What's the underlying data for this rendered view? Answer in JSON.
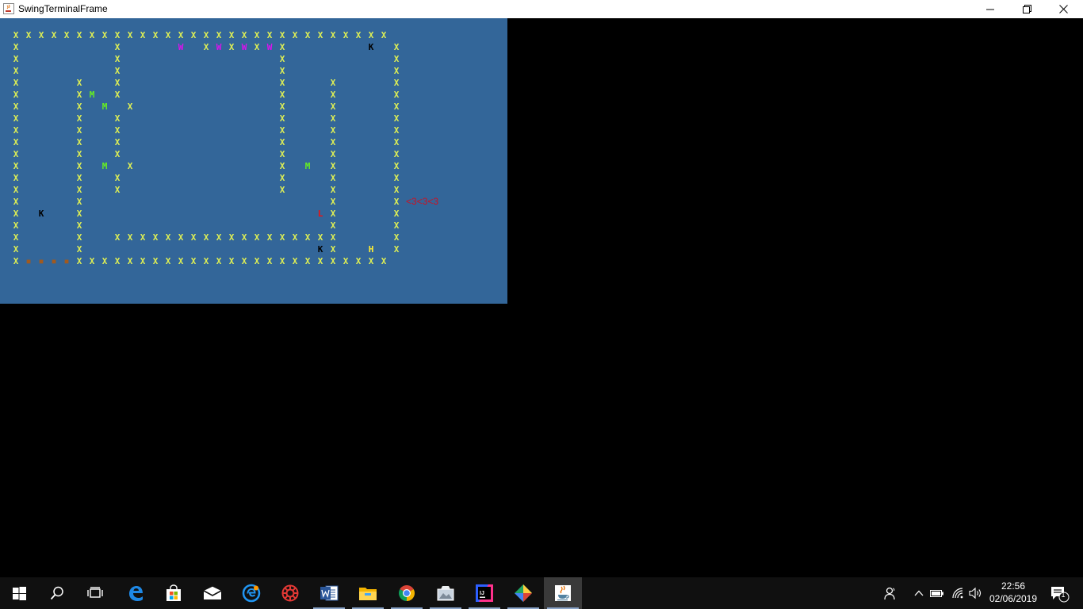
{
  "window": {
    "title": "SwingTerminalFrame"
  },
  "terminal": {
    "background": "#336699",
    "hearts": "<3<3<3",
    "grid_columns": 30,
    "grid_rows": 20,
    "rows": [
      "XXXXXXXXXXXXXXXXXXXXXXXXXXXXXX",
      "X       X    W XWXWXWX      K X",
      "X       X            X        X",
      "X       X            X        X",
      "X    X  X            X   X    X",
      "X    XM X            X   X    X",
      "X    X M X           X   X    X",
      "X    X  X            X   X    X",
      "X    X  X            X   X    X",
      "X    X  X            X   X    X",
      "X    X  X            X   X    X",
      "X    X M X           X M X    X",
      "X    X  X            X   X    X",
      "X    X  X            X   X    X",
      "X    X                   X    X",
      "X K  X                  LX    X",
      "X    X                   X    X",
      "X    X  XXXXXXXXXXXXXXXXXX    X",
      "X    X                  KX  H X",
      "XOOOOXXXXXXXXXXXXXXXXXXXXXXXXX"
    ],
    "colors": {
      "X": "#ddee55",
      "M": "#66ee22",
      "W": "#dd11ee",
      "K": "#000000",
      "L": "#ee1111",
      "H": "#ffee33",
      "O": "#a05a20",
      "hearts": "#cc1122"
    }
  },
  "taskbar": {
    "apps": [
      {
        "name": "start-button",
        "icon": "windows-logo"
      },
      {
        "name": "search-button",
        "icon": "search-icon"
      },
      {
        "name": "task-view-button",
        "icon": "task-view-icon"
      },
      {
        "name": "edge-app",
        "icon": "edge-icon"
      },
      {
        "name": "store-app",
        "icon": "store-icon"
      },
      {
        "name": "mail-app",
        "icon": "mail-icon"
      },
      {
        "name": "app-blue-circle",
        "icon": "circle-e-icon"
      },
      {
        "name": "app-red-gear",
        "icon": "red-gear-icon"
      },
      {
        "name": "word-app",
        "icon": "word-icon"
      },
      {
        "name": "file-explorer-app",
        "icon": "folder-icon"
      },
      {
        "name": "chrome-app",
        "icon": "chrome-icon"
      },
      {
        "name": "app-photos",
        "icon": "photos-icon"
      },
      {
        "name": "intellij-app",
        "icon": "intellij-icon"
      },
      {
        "name": "app-diamond",
        "icon": "diamond-icon"
      },
      {
        "name": "java-app",
        "icon": "java-cup-icon"
      }
    ],
    "clock": {
      "time": "22:56",
      "date": "02/06/2019"
    },
    "notifications_count": "1"
  }
}
